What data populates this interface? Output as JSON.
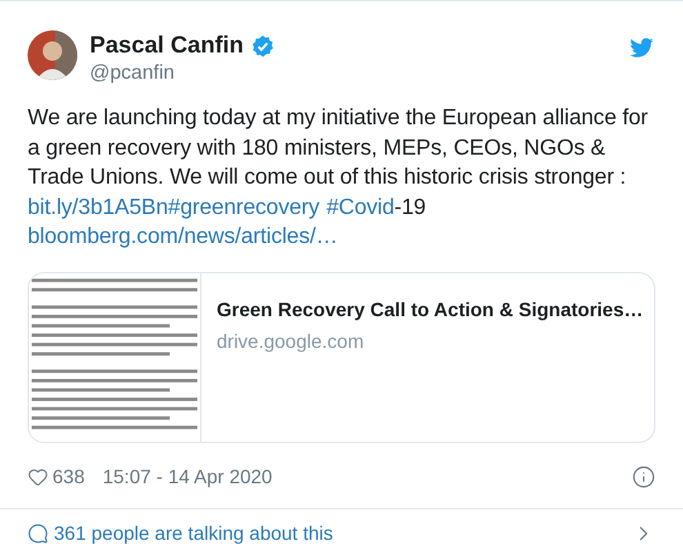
{
  "author": {
    "name": "Pascal Canfin",
    "handle": "@pcanfin",
    "verified": true
  },
  "body": [
    [
      {
        "kind": "text",
        "text": "We are launching today at my initiative the European alliance for"
      }
    ],
    [
      {
        "kind": "text",
        "text": "a green recovery with 180 ministers, MEPs, CEOs, NGOs &"
      }
    ],
    [
      {
        "kind": "text",
        "text": "Trade Unions. We will come out of this historic crisis stronger :"
      }
    ],
    [
      {
        "kind": "link",
        "text": "bit.ly/3b1A5Bn"
      },
      {
        "kind": "link",
        "text": "#greenrecovery"
      },
      {
        "kind": "link",
        "text": "#Covid",
        "space_before": true
      },
      {
        "kind": "text",
        "text": "-19"
      }
    ],
    [
      {
        "kind": "link",
        "text": "bloomberg.com/news/articles/…"
      }
    ]
  ],
  "card": {
    "title": "Green Recovery Call to Action & Signatories…",
    "domain": "drive.google.com"
  },
  "likes": "638",
  "timestamp": "15:07 - 14 Apr 2020",
  "conversation": "361 people are talking about this"
}
